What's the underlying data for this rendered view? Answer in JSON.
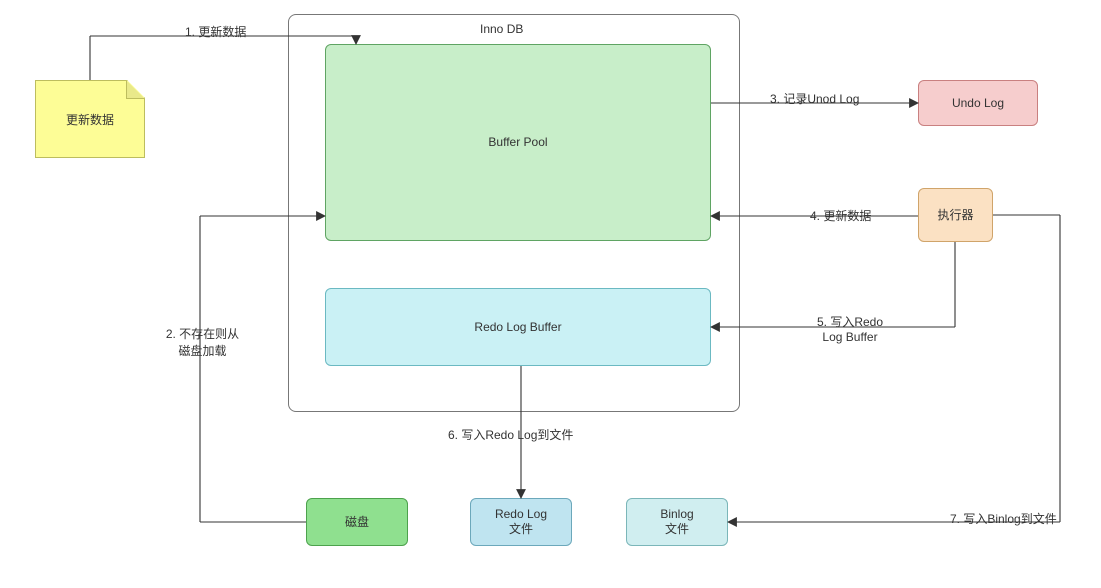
{
  "container": {
    "title": "Inno DB"
  },
  "nodes": {
    "update_data_note": "更新数据",
    "buffer_pool": "Buffer Pool",
    "redo_log_buffer": "Redo Log Buffer",
    "undo_log": "Undo Log",
    "executor": "执行器",
    "disk": "磁盘",
    "redo_log_file": "Redo Log\n文件",
    "binlog_file": "Binlog\n文件"
  },
  "edges": {
    "e1": "1. 更新数据",
    "e2": "2. 不存在则从\n磁盘加载",
    "e3": "3. 记录Unod Log",
    "e4": "4. 更新数据",
    "e5": "5. 写入Redo\nLog Buffer",
    "e6": "6. 写入Redo Log到文件",
    "e7": "7. 写入Binlog到文件"
  },
  "colors": {
    "buffer_pool_fill": "#c8eec9",
    "buffer_pool_stroke": "#5fa463",
    "redo_buffer_fill": "#caf1f5",
    "redo_buffer_stroke": "#6bb9c2",
    "undo_fill": "#f6cdcd",
    "undo_stroke": "#c98080",
    "executor_fill": "#fbe1c3",
    "executor_stroke": "#d0a46a",
    "disk_fill": "#8fe08f",
    "disk_stroke": "#4da24d",
    "redo_file_fill": "#bfe4f0",
    "redo_file_stroke": "#6ca8bb",
    "binlog_fill": "#d0eef0",
    "binlog_stroke": "#7bb6b9",
    "note_fill": "#fdfd96",
    "note_stroke": "#bdbd5e",
    "container_stroke": "#777"
  }
}
